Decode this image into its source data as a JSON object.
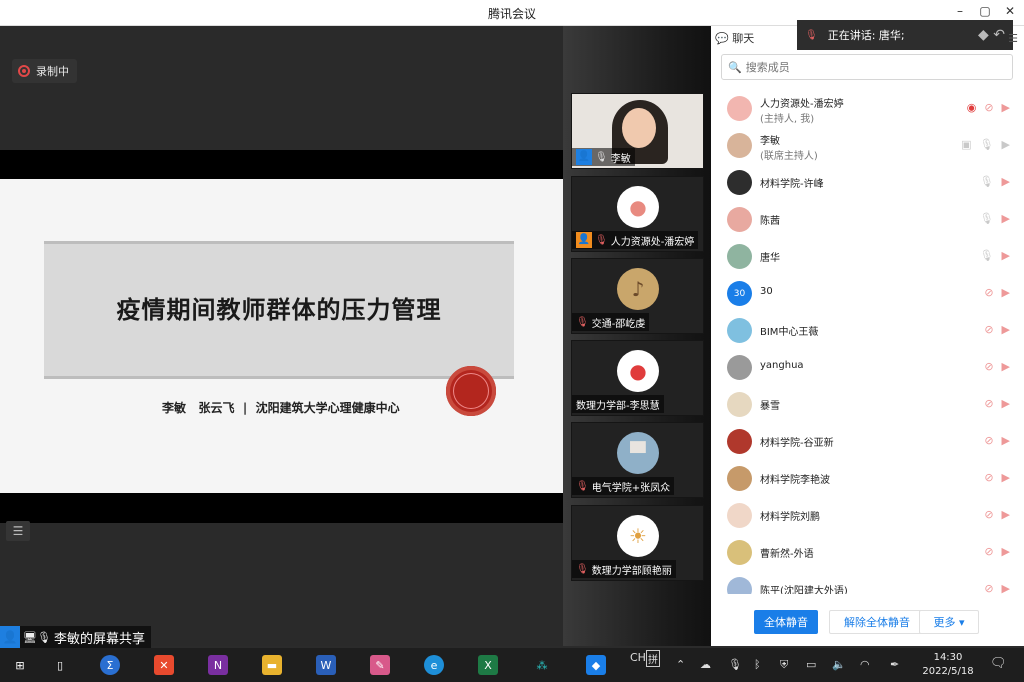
{
  "window": {
    "title": "腾讯会议",
    "controls": [
      "–",
      "▢",
      "✕"
    ]
  },
  "recording": {
    "label": "录制中"
  },
  "slide": {
    "title": "疫情期间教师群体的压力管理",
    "authors": "李敏   张云飞  |  沈阳建筑大学心理健康中心"
  },
  "screenshare": {
    "label": "李敏的屏幕共享"
  },
  "video_tiles": [
    {
      "name": "李敏",
      "role": "host",
      "mic": "on"
    },
    {
      "name": "人力资源处-潘宏婷",
      "role": "host",
      "mic": "muted"
    },
    {
      "name": "交通-邵屹虔",
      "role": "",
      "mic": "muted"
    },
    {
      "name": "数理力学部-李思慧",
      "role": "",
      "mic": "none"
    },
    {
      "name": "电气学院+张凤众",
      "role": "",
      "mic": "muted"
    },
    {
      "name": "数理力学部顾艳丽",
      "role": "",
      "mic": "muted"
    }
  ],
  "panel": {
    "chat_tab": "聊天",
    "speaking_label": "正在讲话: 唐华;",
    "search_placeholder": "搜索成员",
    "members": [
      {
        "name": "人力资源处-潘宏婷",
        "sub": "(主持人, 我)",
        "avatar_color": "#f2b6b0",
        "avatar_text": "",
        "recording": true,
        "mic": "muted",
        "cam": "off"
      },
      {
        "name": "李敏",
        "sub": "(联席主持人)",
        "avatar_color": "#d8b49a",
        "avatar_text": "",
        "recording": false,
        "mic": "on",
        "cam": "on"
      },
      {
        "name": "材料学院-许峰",
        "sub": "",
        "avatar_color": "#2d2d2d",
        "avatar_text": "",
        "recording": false,
        "mic": "on",
        "cam": "off"
      },
      {
        "name": "陈茜",
        "sub": "",
        "avatar_color": "#e8a9a0",
        "avatar_text": "",
        "recording": false,
        "mic": "on",
        "cam": "off"
      },
      {
        "name": "唐华",
        "sub": "",
        "avatar_color": "#8fb4a0",
        "avatar_text": "",
        "recording": false,
        "mic": "on",
        "cam": "off"
      },
      {
        "name": "30",
        "sub": "",
        "avatar_color": "#1a7ee8",
        "avatar_text": "30",
        "recording": false,
        "mic": "muted",
        "cam": "off"
      },
      {
        "name": "BIM中心王薇",
        "sub": "",
        "avatar_color": "#7fc0e0",
        "avatar_text": "",
        "recording": false,
        "mic": "muted",
        "cam": "off"
      },
      {
        "name": "yanghua",
        "sub": "",
        "avatar_color": "#9a9a9a",
        "avatar_text": "",
        "recording": false,
        "mic": "muted",
        "cam": "off"
      },
      {
        "name": "暴雪",
        "sub": "",
        "avatar_color": "#e6d8c0",
        "avatar_text": "",
        "recording": false,
        "mic": "muted",
        "cam": "off"
      },
      {
        "name": "材料学院-谷亚新",
        "sub": "",
        "avatar_color": "#b0382c",
        "avatar_text": "",
        "recording": false,
        "mic": "muted",
        "cam": "off"
      },
      {
        "name": "材料学院李艳波",
        "sub": "",
        "avatar_color": "#c69a6a",
        "avatar_text": "",
        "recording": false,
        "mic": "muted",
        "cam": "off"
      },
      {
        "name": "材料学院刘鹏",
        "sub": "",
        "avatar_color": "#f0d7c8",
        "avatar_text": "",
        "recording": false,
        "mic": "muted",
        "cam": "off"
      },
      {
        "name": "曹新然-外语",
        "sub": "",
        "avatar_color": "#d9c07a",
        "avatar_text": "",
        "recording": false,
        "mic": "muted",
        "cam": "off"
      },
      {
        "name": "陈平(沈阳建大外语)",
        "sub": "",
        "avatar_color": "#a0b8d8",
        "avatar_text": "",
        "recording": false,
        "mic": "muted",
        "cam": "off"
      }
    ],
    "buttons": {
      "mute_all": "全体静音",
      "unmute_all": "解除全体静音",
      "more": "更多 ▾"
    }
  },
  "taskbar": {
    "lang": "CH",
    "ime": "拼",
    "time": "14:30",
    "date": "2022/5/18",
    "apps": [
      "start-icon",
      "task-view-icon",
      "sigma-app-icon",
      "red-x-app-icon",
      "onenote-icon",
      "file-explorer-icon",
      "word-icon",
      "paint-icon",
      "edge-icon",
      "excel-icon",
      "network-app-icon",
      "tencent-meeting-icon"
    ]
  }
}
